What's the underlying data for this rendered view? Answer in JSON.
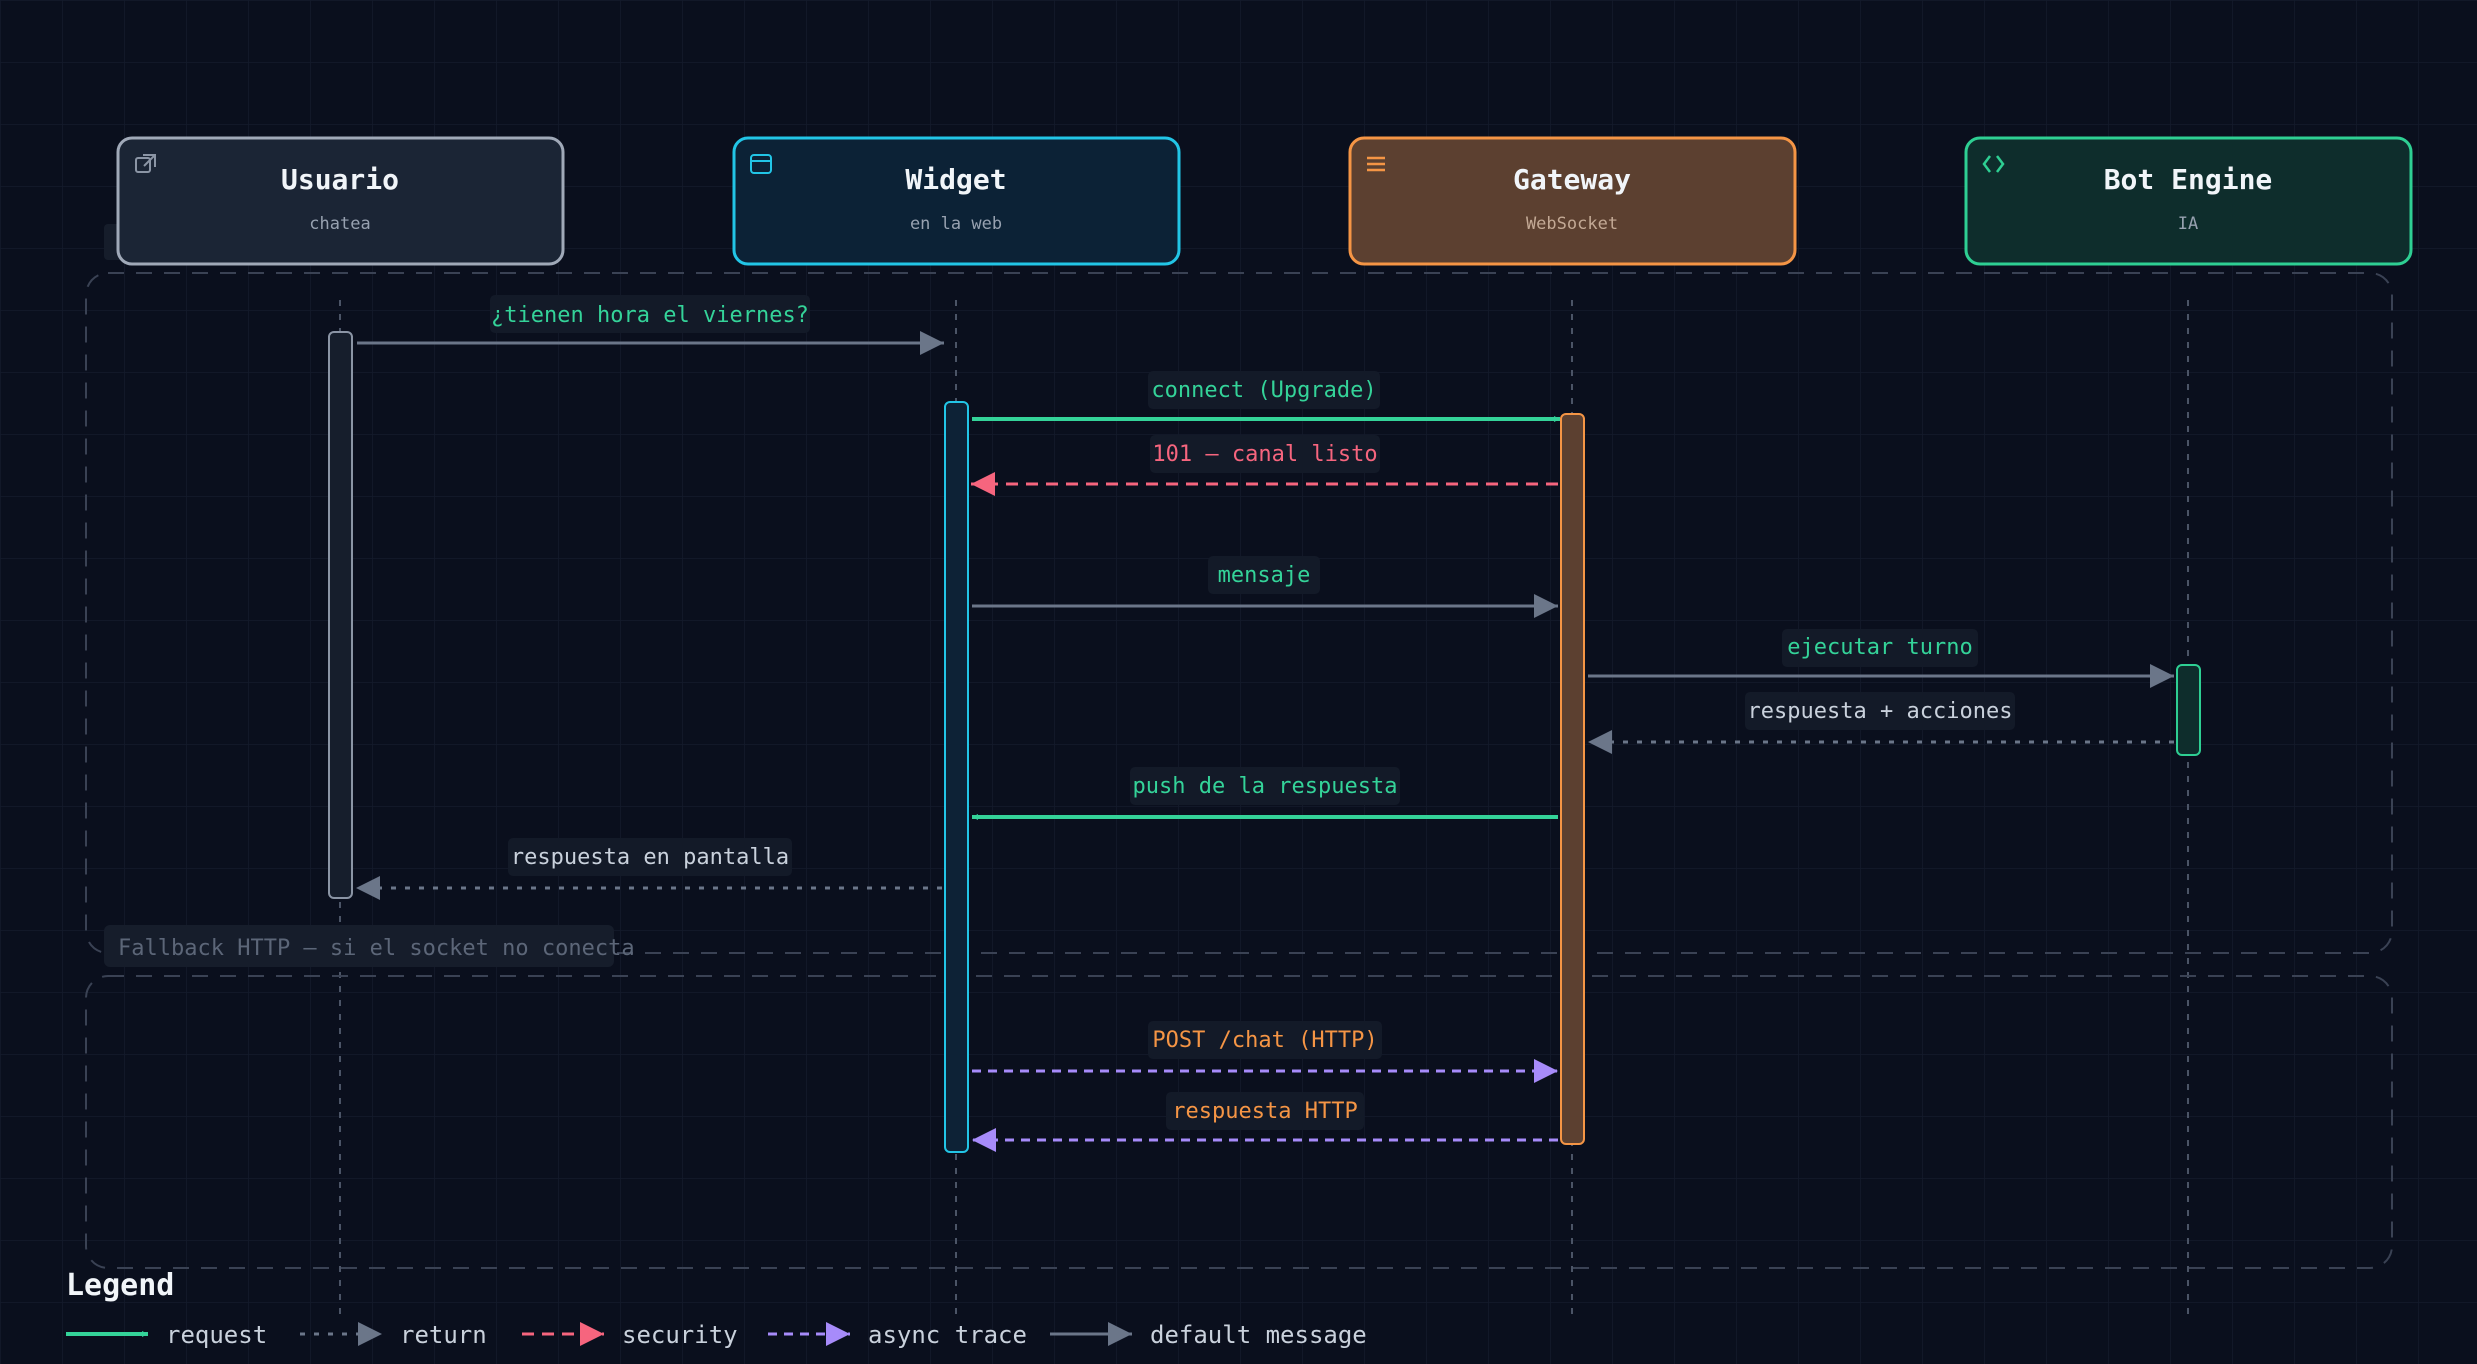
{
  "participants": [
    {
      "id": "usuario",
      "name": "Usuario",
      "subtitle": "chatea",
      "icon": "external-link-icon",
      "stroke": "#a0a9b8",
      "fill": "#1b2535"
    },
    {
      "id": "widget",
      "name": "Widget",
      "subtitle": "en la web",
      "icon": "browser-window-icon",
      "stroke": "#22c5e6",
      "fill": "#0c2236"
    },
    {
      "id": "gateway",
      "name": "Gateway",
      "subtitle": "WebSocket",
      "icon": "menu-lines-icon",
      "stroke": "#f59545",
      "fill": "#5c4030"
    },
    {
      "id": "bot",
      "name": "Bot Engine",
      "subtitle": "IA",
      "icon": "code-brackets-icon",
      "stroke": "#2ecf93",
      "fill": "#0e2d2c"
    }
  ],
  "fragment": {
    "label": "Fallback HTTP — si el socket no conecta"
  },
  "messages": [
    {
      "id": "m1",
      "label": "¿tienen hora el viernes?",
      "type": "default",
      "label_color": "#34d399"
    },
    {
      "id": "m2",
      "label": "connect (Upgrade)",
      "type": "request",
      "label_color": "#34d399"
    },
    {
      "id": "m3",
      "label": "101 — canal listo",
      "type": "security",
      "label_color": "#f6657e"
    },
    {
      "id": "m4",
      "label": "mensaje",
      "type": "default",
      "label_color": "#34d399"
    },
    {
      "id": "m5",
      "label": "ejecutar turno",
      "type": "default",
      "label_color": "#34d399"
    },
    {
      "id": "m6",
      "label": "respuesta + acciones",
      "type": "return",
      "label_color": "#c9d1dc"
    },
    {
      "id": "m7",
      "label": "push de la respuesta",
      "type": "request",
      "label_color": "#34d399"
    },
    {
      "id": "m8",
      "label": "respuesta en pantalla",
      "type": "return",
      "label_color": "#c9d1dc"
    },
    {
      "id": "m9",
      "label": "POST /chat (HTTP)",
      "type": "async",
      "label_color": "#f59545"
    },
    {
      "id": "m10",
      "label": "respuesta HTTP",
      "type": "async",
      "label_color": "#f59545"
    }
  ],
  "legend": {
    "title": "Legend",
    "items": [
      {
        "id": "request",
        "label": "request"
      },
      {
        "id": "return",
        "label": "return"
      },
      {
        "id": "security",
        "label": "security"
      },
      {
        "id": "async",
        "label": "async trace"
      },
      {
        "id": "default",
        "label": "default message"
      }
    ]
  },
  "colors": {
    "request": "#34d399",
    "return": "#6b7689",
    "security": "#f6657e",
    "async": "#a78bfa",
    "default": "#6b7689",
    "background": "#0a0f1d"
  }
}
